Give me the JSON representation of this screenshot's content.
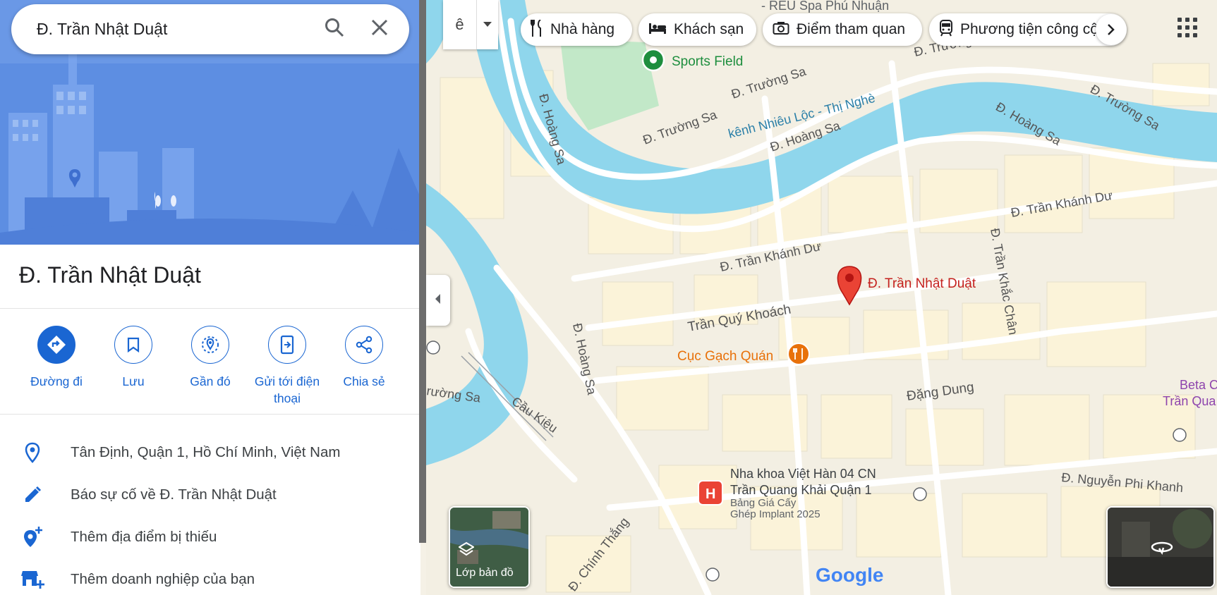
{
  "search": {
    "value": "Đ. Trần Nhật Duật",
    "search_icon": "search-icon",
    "close_icon": "close-icon"
  },
  "place": {
    "title": "Đ. Trần Nhật Duật"
  },
  "actions": [
    {
      "label": "Đường đi",
      "icon": "directions-icon"
    },
    {
      "label": "Lưu",
      "icon": "bookmark-icon"
    },
    {
      "label": "Gần đó",
      "icon": "nearby-icon"
    },
    {
      "label": "Gửi tới điện thoại",
      "icon": "send-to-phone-icon"
    },
    {
      "label": "Chia sẻ",
      "icon": "share-icon"
    }
  ],
  "info_rows": [
    {
      "text": "Tân Định, Quận 1, Hồ Chí Minh, Việt Nam",
      "icon": "location-pin-icon"
    },
    {
      "text": "Báo sự cố về Đ. Trần Nhật Duật",
      "icon": "pencil-icon"
    },
    {
      "text": "Thêm địa điểm bị thiếu",
      "icon": "add-location-icon"
    },
    {
      "text": "Thêm doanh nghiệp của bạn",
      "icon": "add-business-icon"
    }
  ],
  "chips": [
    {
      "label": "Nhà hàng",
      "icon": "restaurant-icon"
    },
    {
      "label": "Khách sạn",
      "icon": "hotel-icon"
    },
    {
      "label": "Điểm tham quan",
      "icon": "camera-icon"
    },
    {
      "label": "Phương tiện công cộng",
      "icon": "transit-icon"
    }
  ],
  "lang_button": "ê",
  "layers_label": "Lớp bản đồ",
  "map_labels": {
    "spa": "- REU Spa Phú Nhuận",
    "sports_field": "Sports Field",
    "truong_sa_1": "Đ. Trường Sa",
    "truong_sa_2": "Đ. Trường Sa",
    "truong_sa_3": "Đ. Trường Sa",
    "truong_sa_4": "Đ. Trường Sa",
    "truong_sa_5": "rường Sa",
    "canal": "kênh Nhiêu Lộc - Thị Nghè",
    "hoang_sa_1": "Đ. Hoàng Sa",
    "hoang_sa_2": "Đ. Hoàng Sa",
    "hoang_sa_3": "Đ. Hoàng Sa",
    "hoang_sa_4": "Đ. Hoàng Sa",
    "tran_khanh_du_1": "Đ. Trần Khánh Dư",
    "tran_khanh_du_2": "Đ. Trần Khánh Dư",
    "tran_khac_chan": "Đ. Trần Khắc Chân",
    "tran_quy_khoach": "Trần Quý Khoách",
    "pin_label": "Đ. Trần Nhật Duật",
    "cuc_gach": "Cục Gạch Quán",
    "dang_dung": "Đặng Dung",
    "cau_kieu": "Cầu Kiệu",
    "beta_1": "Beta C",
    "beta_2": "Trần Qua",
    "nguyen_phi_khanh": "Đ. Nguyễn Phi Khanh",
    "nha_khoa_1": "Nha khoa Việt Hàn 04 CN",
    "nha_khoa_2": "Trần Quang Khải Quận 1",
    "nha_khoa_3": "Bảng Giá Cấy",
    "nha_khoa_4": "Ghép Implant 2025",
    "chinh_thang": "Đ. Chính Thắng",
    "google": "Google"
  },
  "colors": {
    "accent": "#1a66d2",
    "water": "#8fd6ec",
    "map_bg": "#f5f1e6",
    "pin": "#ea4335",
    "restaurant": "#e8710a",
    "park": "#c2e8c8"
  }
}
